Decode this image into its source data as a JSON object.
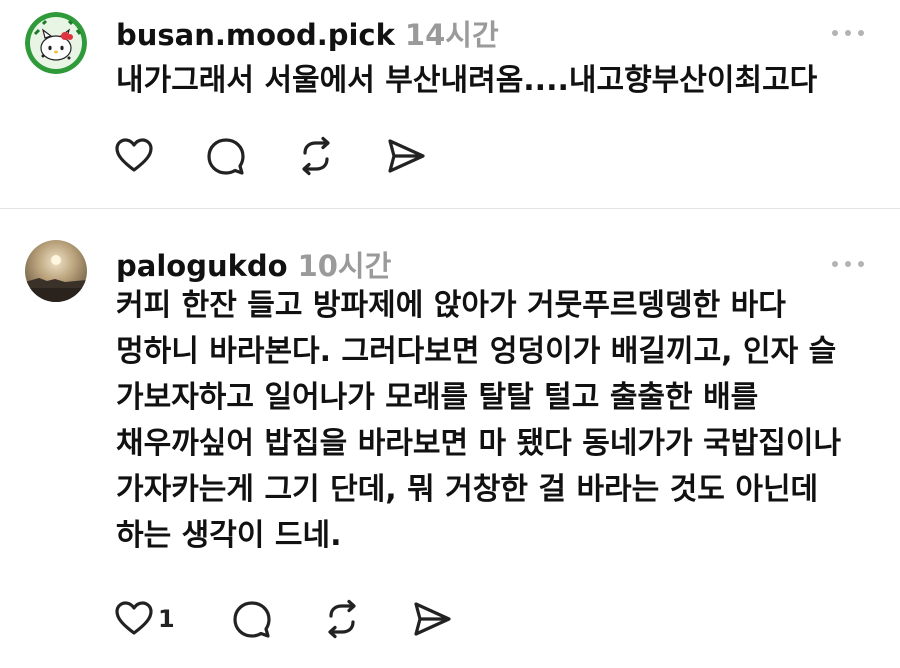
{
  "posts": [
    {
      "username": "busan.mood.pick",
      "time": "14시간",
      "avatar": "hello-kitty-watermelon-avatar",
      "lines": [
        "내가그래서 서울에서 부산내려옴....내고향부산이최고다"
      ],
      "like_count": ""
    },
    {
      "username": "palogukdo",
      "time": "10시간",
      "avatar": "sunset-sea-avatar",
      "lines": [
        "커피 한잔 들고 방파제에 앉아가 거뭇푸르뎅뎅한 바다",
        "멍하니 바라본다. 그러다보면 엉덩이가 배길끼고, 인자 슬",
        "가보자하고 일어나가 모래를 탈탈 털고 출출한 배를",
        "채우까싶어 밥집을 바라보면 마 됐다 동네가가 국밥집이나",
        "가자카는게 그기 단데, 뭐 거창한 걸 바라는 것도 아닌데",
        "하는 생각이 드네."
      ],
      "like_count": "1"
    }
  ],
  "icons": {
    "like": "heart-icon",
    "reply": "comment-bubble-icon",
    "repost": "repost-icon",
    "share": "send-icon",
    "more": "more-dots-icon"
  },
  "colors": {
    "text": "#111111",
    "muted": "#9a9a9a",
    "divider": "#e4e4e4",
    "dots": "#b3b3b3"
  }
}
